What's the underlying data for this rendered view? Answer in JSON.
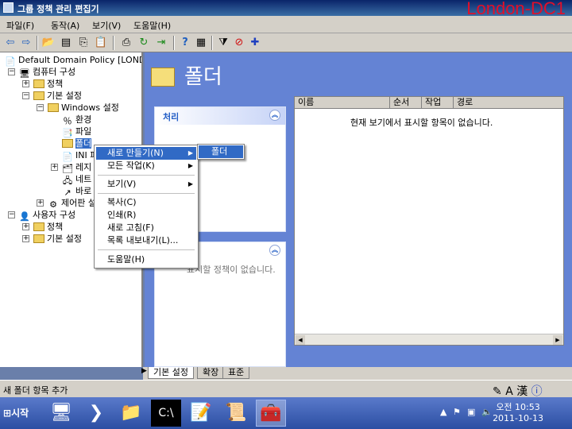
{
  "window": {
    "title": "그룹 정책 관리 편집기",
    "server_label": "London-DC1"
  },
  "menubar": [
    "파일(F)",
    "동작(A)",
    "보기(V)",
    "도움말(H)"
  ],
  "toolbar": [
    "back-icon",
    "forward-icon",
    "up-icon",
    "console-tree-icon",
    "copy-icon",
    "paste-icon",
    "print-icon",
    "refresh-icon",
    "export-icon",
    "help-icon",
    "properties-icon",
    "filter-icon",
    "delete-icon",
    "new-icon"
  ],
  "tree": {
    "root": "Default Domain Policy [LOND",
    "computer_config": "컴퓨터 구성",
    "policies": "정책",
    "preferences": "기본 설정",
    "windows_settings": "Windows 설정",
    "environment": "환경",
    "files": "파일",
    "folders": "폴더",
    "ini_files": "INI 파",
    "registry": "레지",
    "network_shares": "네트",
    "shortcuts": "바로",
    "control_panel": "제어판 설",
    "user_config": "사용자 구성",
    "user_policies": "정책",
    "user_preferences": "기본 설정"
  },
  "header": {
    "title": "폴더"
  },
  "panel_top": {
    "title": "처리"
  },
  "panel_bottom": {
    "text": "표시할 정책이 없습니다."
  },
  "listview": {
    "columns": [
      "이름",
      "순서",
      "작업",
      "경로"
    ],
    "empty_text": "현재 보기에서 표시할 항목이 없습니다."
  },
  "tabs": [
    "기본 설정",
    "확장",
    "표준"
  ],
  "status": {
    "text": "새 폴더 항목 추가"
  },
  "context_menu": {
    "new": "새로 만들기(N)",
    "all_tasks": "모든 작업(K)",
    "view": "보기(V)",
    "paste": "복사(C)",
    "print": "인쇄(R)",
    "refresh": "새로 고침(F)",
    "export": "목록 내보내기(L)...",
    "help": "도움말(H)"
  },
  "submenu": {
    "folder": "폴더"
  },
  "taskbar": {
    "start": "시작",
    "time": "오전 10:53",
    "date": "2011-10-13",
    "lang": "A 漢"
  }
}
